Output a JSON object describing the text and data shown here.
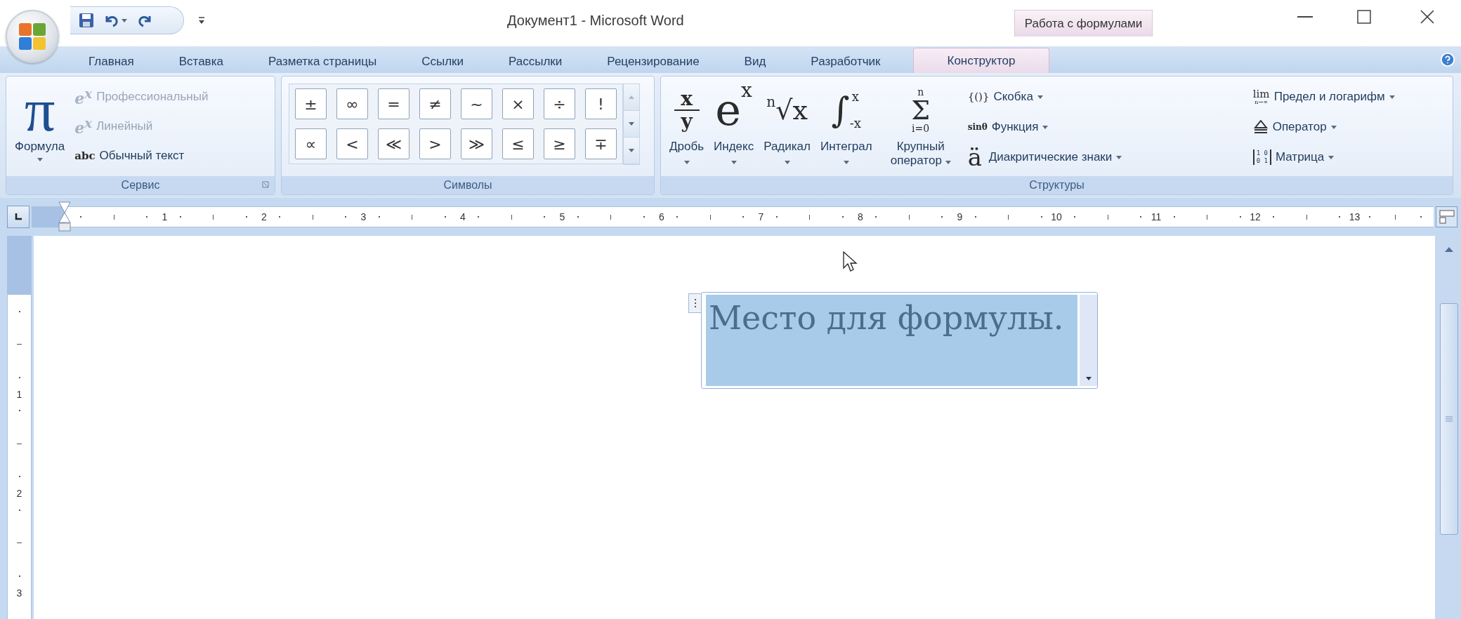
{
  "window": {
    "title": "Документ1 - Microsoft Word",
    "context_label": "Работа с формулами"
  },
  "tabs": [
    {
      "label": "Главная",
      "selected": false
    },
    {
      "label": "Вставка",
      "selected": false
    },
    {
      "label": "Разметка страницы",
      "selected": false
    },
    {
      "label": "Ссылки",
      "selected": false
    },
    {
      "label": "Рассылки",
      "selected": false
    },
    {
      "label": "Рецензирование",
      "selected": false
    },
    {
      "label": "Вид",
      "selected": false
    },
    {
      "label": "Разработчик",
      "selected": false
    },
    {
      "label": "Конструктор",
      "selected": true
    }
  ],
  "ribbon": {
    "service": {
      "label": "Сервис",
      "formula": {
        "icon": "π",
        "label": "Формула"
      },
      "modes": [
        {
          "icon": "e$^{x}$",
          "label": "Профессиональный",
          "disabled": true
        },
        {
          "icon": "e$^{x}$",
          "label": "Линейный",
          "disabled": true
        },
        {
          "icon": "abc",
          "label": "Обычный текст",
          "disabled": false
        }
      ]
    },
    "symbols": {
      "label": "Символы",
      "items": [
        "±",
        "∞",
        "=",
        "≠",
        "~",
        "×",
        "÷",
        "!",
        "∝",
        "<",
        "≪",
        ">",
        "≫",
        "≤",
        "≥",
        "∓"
      ]
    },
    "structures": {
      "label": "Структуры",
      "large": [
        {
          "kind": "fraction",
          "glyphs": [
            "x",
            "y"
          ],
          "label": "Дробь"
        },
        {
          "kind": "script",
          "glyphs": [
            "e",
            "x"
          ],
          "label": "Индекс"
        },
        {
          "kind": "radical",
          "glyphs": [
            "n",
            "√x"
          ],
          "label": "Радикал"
        },
        {
          "kind": "integral",
          "glyphs": [
            "∫",
            "x",
            "-x"
          ],
          "label": "Интеграл"
        },
        {
          "kind": "large_operator",
          "glyphs": [
            "n",
            "Σ",
            "i=0"
          ],
          "label": "Крупный оператор"
        }
      ],
      "small": [
        {
          "kind": "bracket",
          "glyphs": [
            "{()}"
          ],
          "label": "Скобка"
        },
        {
          "kind": "function",
          "glyphs": [
            "sinθ"
          ],
          "label": "Функция"
        },
        {
          "kind": "accent",
          "glyphs": [
            "ä"
          ],
          "label": "Диакритические знаки"
        },
        {
          "kind": "limit",
          "glyphs": [
            "lim",
            "n→∞"
          ],
          "label": "Предел и логарифм"
        },
        {
          "kind": "operator",
          "label": "Оператор"
        },
        {
          "kind": "matrix",
          "glyphs": [
            "1 0",
            "0 1"
          ],
          "label": "Матрица"
        }
      ]
    }
  },
  "ruler": {
    "horizontal": [
      "1",
      "2",
      "3",
      "4",
      "5",
      "6",
      "7",
      "8",
      "9",
      "10",
      "11",
      "12",
      "13"
    ],
    "vertical": [
      "1",
      "2",
      "3"
    ]
  },
  "equation": {
    "text": "Место для формулы.",
    "selected": true
  }
}
